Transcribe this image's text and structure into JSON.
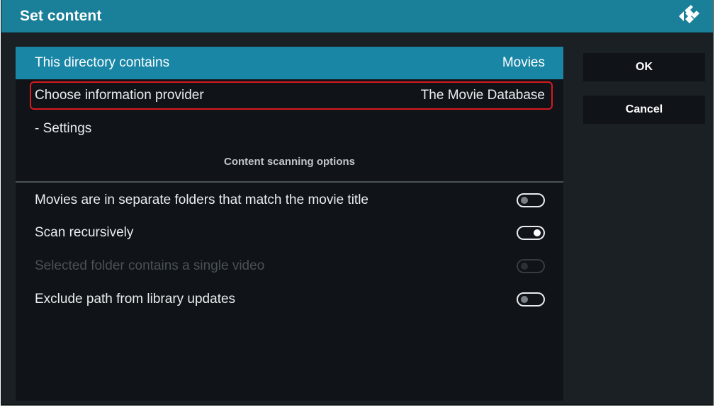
{
  "dialog": {
    "title": "Set content",
    "logo_icon": "kodi-logo-icon"
  },
  "settings": {
    "directory_contains": {
      "label": "This directory contains",
      "value": "Movies"
    },
    "info_provider": {
      "label": "Choose information provider",
      "value": "The Movie Database"
    },
    "provider_settings": {
      "label": "- Settings"
    }
  },
  "scanning": {
    "header": "Content scanning options",
    "options": [
      {
        "label": "Movies are in separate folders that match the movie title",
        "state": "off",
        "enabled": true
      },
      {
        "label": "Scan recursively",
        "state": "on",
        "enabled": true
      },
      {
        "label": "Selected folder contains a single video",
        "state": "off",
        "enabled": false
      },
      {
        "label": "Exclude path from library updates",
        "state": "off",
        "enabled": true
      }
    ]
  },
  "buttons": {
    "ok": "OK",
    "cancel": "Cancel"
  },
  "colors": {
    "titlebar": "#1a7f98",
    "focus": "#1a86a6",
    "highlight_border": "#d61a1f",
    "panel": "#101418",
    "background": "#1b2024"
  }
}
